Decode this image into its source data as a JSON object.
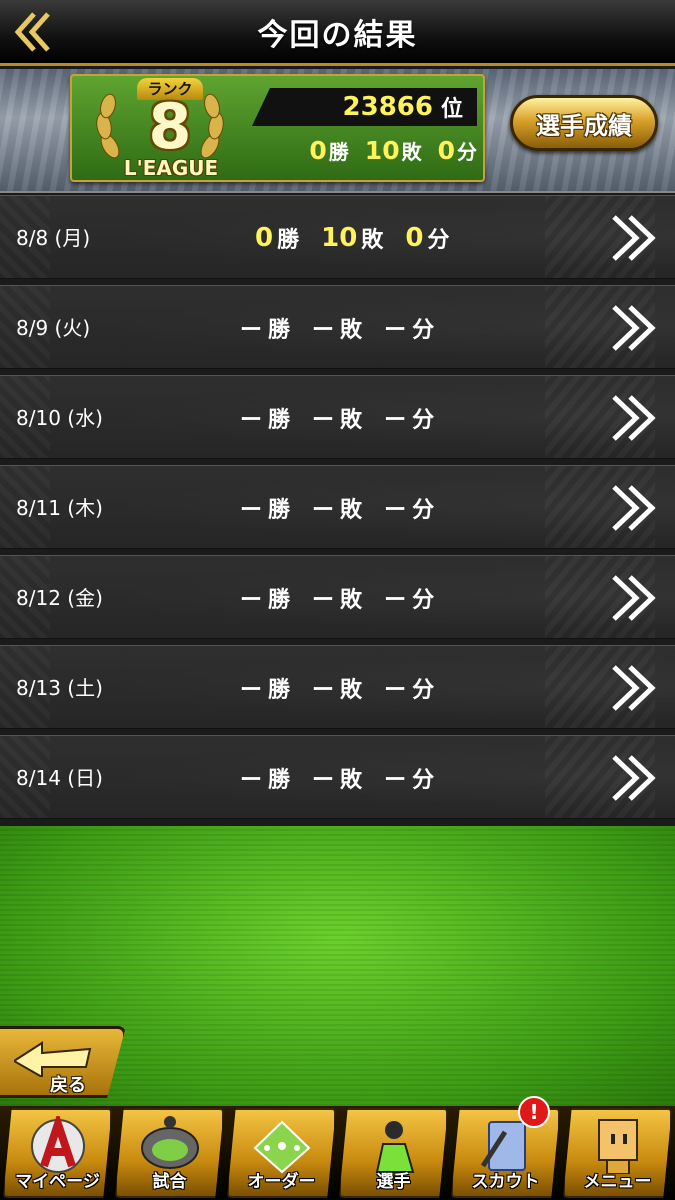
{
  "header": {
    "title": "今回の結果",
    "back_icon": "double-chevron-left-icon"
  },
  "summary": {
    "rank_label": "ランク",
    "rank_number": "8",
    "league_label": "L'EAGUE",
    "place_value": "23866",
    "place_unit": "位",
    "wins": "0",
    "wins_unit": "勝",
    "losses": "10",
    "losses_unit": "敗",
    "draws": "0",
    "draws_unit": "分",
    "player_stats_label": "選手成績"
  },
  "results": [
    {
      "date": "8/8 (月)",
      "wins": "0",
      "losses": "10",
      "draws": "0",
      "has_data": true
    },
    {
      "date": "8/9 (火)",
      "wins": "",
      "losses": "",
      "draws": "",
      "has_data": false
    },
    {
      "date": "8/10 (水)",
      "wins": "",
      "losses": "",
      "draws": "",
      "has_data": false
    },
    {
      "date": "8/11 (木)",
      "wins": "",
      "losses": "",
      "draws": "",
      "has_data": false
    },
    {
      "date": "8/12 (金)",
      "wins": "",
      "losses": "",
      "draws": "",
      "has_data": false
    },
    {
      "date": "8/13 (土)",
      "wins": "",
      "losses": "",
      "draws": "",
      "has_data": false
    },
    {
      "date": "8/14 (日)",
      "wins": "",
      "losses": "",
      "draws": "",
      "has_data": false
    }
  ],
  "units": {
    "win": "勝",
    "loss": "敗",
    "draw": "分",
    "dash": "ー"
  },
  "back_button": {
    "label": "戻る"
  },
  "nav": [
    {
      "label": "マイページ",
      "icon": "mypage-a-icon"
    },
    {
      "label": "試合",
      "icon": "match-field-icon"
    },
    {
      "label": "オーダー",
      "icon": "order-diamond-icon"
    },
    {
      "label": "選手",
      "icon": "player-icon"
    },
    {
      "label": "スカウト",
      "icon": "scout-card-icon"
    },
    {
      "label": "メニュー",
      "icon": "menu-character-icon"
    }
  ],
  "notice_badge": "!",
  "colors": {
    "accent_yellow": "#fff25a",
    "gold": "#c9a235",
    "field_green": "#4caf1c"
  }
}
